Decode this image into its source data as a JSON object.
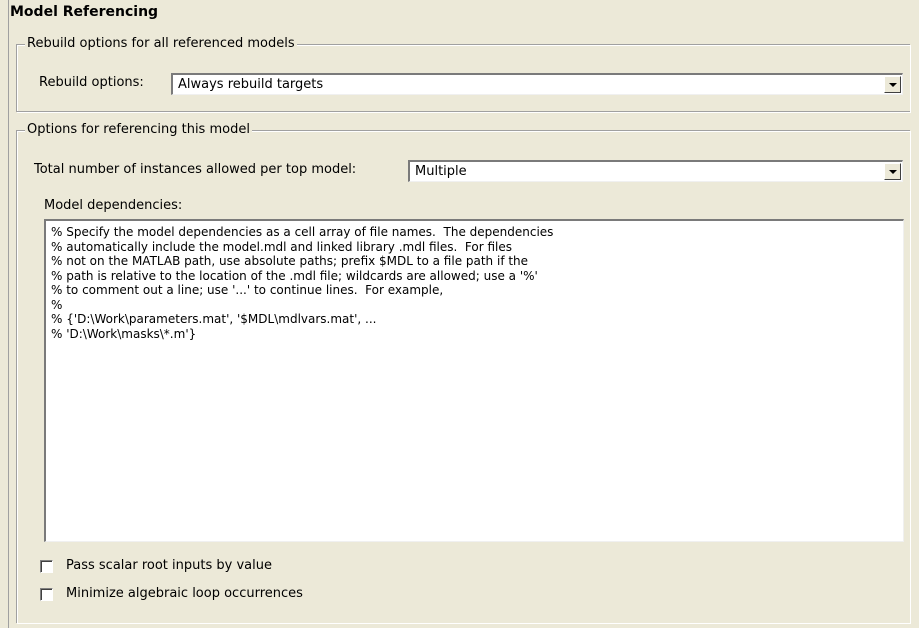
{
  "title": "Model Referencing",
  "rebuild_group": {
    "legend": "Rebuild options for all referenced models",
    "label": "Rebuild options:",
    "selected": "Always rebuild targets"
  },
  "ref_group": {
    "legend": "Options for referencing this model",
    "instances_label": "Total number of instances allowed per top model:",
    "instances_selected": "Multiple",
    "deps_label": "Model dependencies:",
    "deps_lines": [
      "% Specify the model dependencies as a cell array of file names.  The dependencies",
      "% automatically include the model.mdl and linked library .mdl files.  For files",
      "% not on the MATLAB path, use absolute paths; prefix $MDL to a file path if the",
      "% path is relative to the location of the .mdl file; wildcards are allowed; use a '%'",
      "% to comment out a line; use '...' to continue lines.  For example,",
      "%",
      "% {'D:\\Work\\parameters.mat', '$MDL\\mdlvars.mat', ...",
      "% 'D:\\Work\\masks\\*.m'}"
    ],
    "check_pass_scalar": "Pass scalar root inputs by value",
    "check_pass_scalar_checked": false,
    "check_minimize": "Minimize algebraic loop occurrences",
    "check_minimize_checked": false
  }
}
